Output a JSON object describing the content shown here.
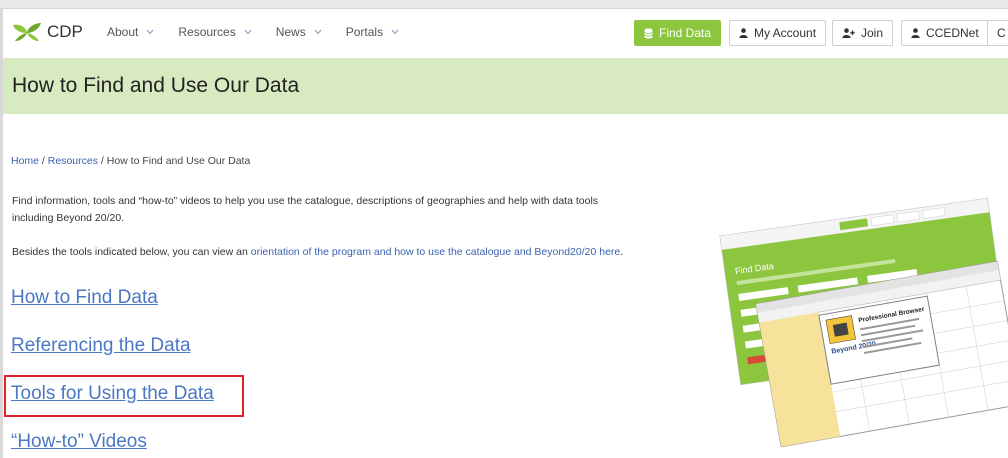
{
  "brand": {
    "name": "CDP"
  },
  "nav": [
    {
      "label": "About"
    },
    {
      "label": "Resources"
    },
    {
      "label": "News"
    },
    {
      "label": "Portals"
    }
  ],
  "header_buttons": {
    "find_data": "Find Data",
    "my_account": "My Account",
    "join": "Join",
    "ccednet": "CCEDNet",
    "cut_off": "C"
  },
  "page_title": "How to Find and Use Our Data",
  "breadcrumb": {
    "home": "Home",
    "sep1": " / ",
    "resources": "Resources",
    "sep2": " / ",
    "current": "How to Find and Use Our Data"
  },
  "intro": {
    "line1": "Find information, tools and “how-to” videos to help you use the catalogue, descriptions of geographies and help with data tools",
    "line2": "including Beyond 20/20.",
    "besides_prefix": "Besides the tools indicated below, you can view an ",
    "besides_link": "orientation of the program and how to use the catalogue and Beyond20/20 here",
    "besides_suffix": "."
  },
  "sections": [
    {
      "label": "How to Find Data"
    },
    {
      "label": "Referencing the Data"
    },
    {
      "label": "Tools for Using the Data",
      "highlighted": true
    },
    {
      "label": "“How-to” Videos"
    }
  ],
  "collage": {
    "top_title": "Find Data",
    "bottom_title": "Professional Browser",
    "bottom_logo": "Beyond 20/20"
  },
  "colors": {
    "brand_green": "#8cc63f",
    "banner_bg": "#d8ebc0",
    "link_blue": "#4a78c4",
    "highlight_red": "#e0242a"
  }
}
